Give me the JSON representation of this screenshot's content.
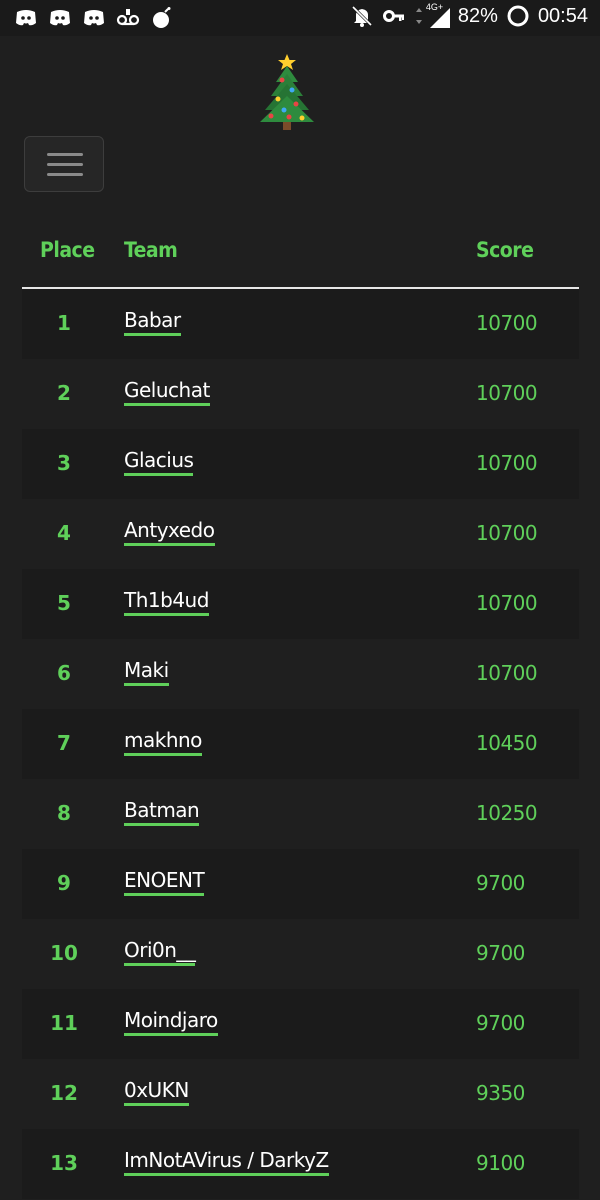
{
  "status_bar": {
    "network": "4G+",
    "battery": "82%",
    "time": "00:54",
    "left_icons": [
      "discord-icon",
      "discord-icon",
      "discord-icon",
      "voicemail-icon",
      "bomb-icon"
    ],
    "right_icons": [
      "bell-off-icon",
      "vpn-key-icon",
      "data-arrows-icon",
      "signal-icon",
      "battery-ring-icon"
    ]
  },
  "logo": {
    "icon": "christmas-tree-icon"
  },
  "menu": {
    "icon": "hamburger-icon"
  },
  "colors": {
    "accent": "#5fd05a",
    "background": "#1f1f1f",
    "text": "#ffffff"
  },
  "table": {
    "headers": {
      "place": "Place",
      "team": "Team",
      "score": "Score"
    },
    "rows": [
      {
        "place": "1",
        "team": "Babar",
        "score": "10700"
      },
      {
        "place": "2",
        "team": "Geluchat",
        "score": "10700"
      },
      {
        "place": "3",
        "team": "Glacius",
        "score": "10700"
      },
      {
        "place": "4",
        "team": "Antyxedo",
        "score": "10700"
      },
      {
        "place": "5",
        "team": "Th1b4ud",
        "score": "10700"
      },
      {
        "place": "6",
        "team": "Maki",
        "score": "10700"
      },
      {
        "place": "7",
        "team": "makhno",
        "score": "10450"
      },
      {
        "place": "8",
        "team": "Batman",
        "score": "10250"
      },
      {
        "place": "9",
        "team": "ENOENT",
        "score": "9700"
      },
      {
        "place": "10",
        "team": "Ori0n__",
        "score": "9700"
      },
      {
        "place": "11",
        "team": "Moindjaro",
        "score": "9700"
      },
      {
        "place": "12",
        "team": "0xUKN",
        "score": "9350"
      },
      {
        "place": "13",
        "team": "ImNotAVirus / DarkyZ",
        "score": "9100"
      }
    ]
  }
}
